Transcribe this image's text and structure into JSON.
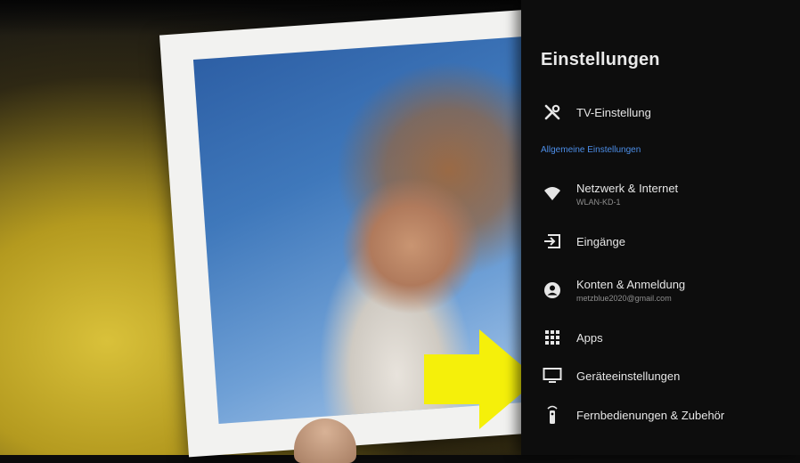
{
  "panel": {
    "title": "Einstellungen",
    "section_general": "Allgemeine Einstellungen",
    "items": [
      {
        "label": "TV-Einstellung",
        "icon": "tools-icon"
      },
      {
        "label": "Netzwerk & Internet",
        "sub": "WLAN-KD-1",
        "icon": "wifi-icon"
      },
      {
        "label": "Eingänge",
        "icon": "input-icon"
      },
      {
        "label": "Konten & Anmeldung",
        "sub": "metzblue2020@gmail.com",
        "icon": "account-icon"
      },
      {
        "label": "Apps",
        "icon": "apps-grid-icon"
      },
      {
        "label": "Geräteeinstellungen",
        "icon": "tv-icon"
      },
      {
        "label": "Fernbedienungen & Zubehör",
        "icon": "remote-icon"
      }
    ]
  },
  "colors": {
    "panel_bg": "#0d0d0d",
    "section_header": "#4c8ee8",
    "arrow": "#f5f00a"
  }
}
